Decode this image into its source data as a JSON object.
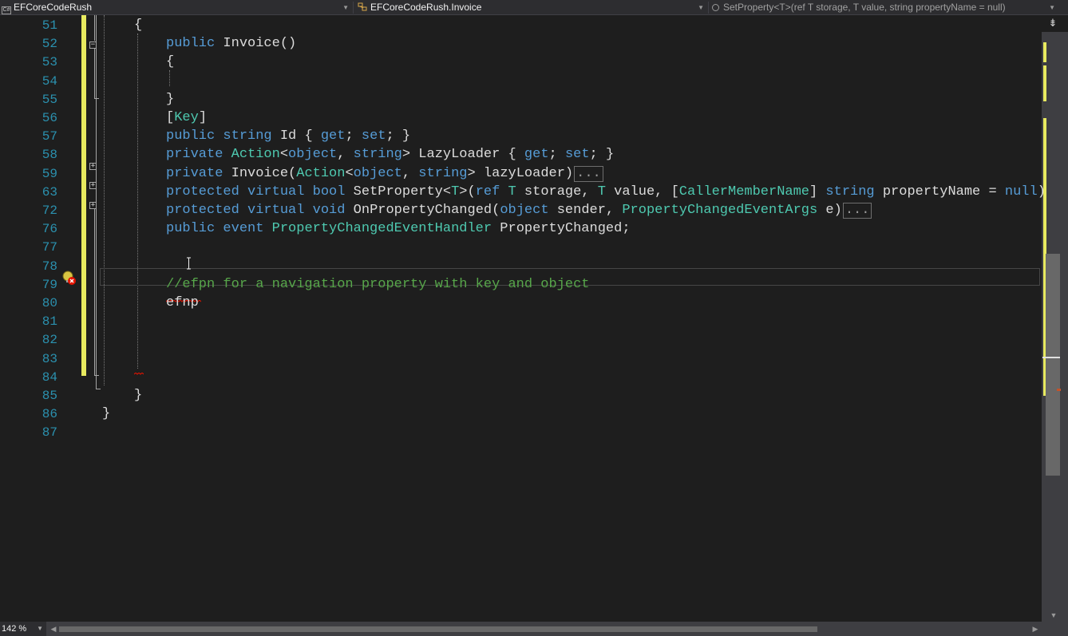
{
  "nav_bar": {
    "project": "EFCoreCodeRush",
    "class": "EFCoreCodeRush.Invoice",
    "member": "SetProperty<T>(ref T storage, T value, string propertyName = null)"
  },
  "icons": {
    "project": "csharp-project-icon",
    "class": "class-icon",
    "member": "method-icon",
    "split": "split-window-icon",
    "lightbulb": "lightbulb-error-icon"
  },
  "colors": {
    "keyword": "#569cd6",
    "type": "#4ec9b0",
    "comment": "#57a64a",
    "line_number": "#2b91af",
    "change_bar": "#e8ea5f"
  },
  "editor": {
    "line_numbers": [
      "51",
      "52",
      "53",
      "54",
      "55",
      "56",
      "57",
      "58",
      "59",
      "63",
      "72",
      "76",
      "77",
      "78",
      "79",
      "80",
      "81",
      "82",
      "83",
      "84",
      "85",
      "86",
      "87"
    ],
    "code_lines": [
      {
        "tokens": [
          {
            "t": "{",
            "c": "pl"
          }
        ]
      },
      {
        "tokens": [
          {
            "t": "public",
            "c": "kw"
          },
          {
            "t": " Invoice()",
            "c": "pl"
          }
        ]
      },
      {
        "tokens": [
          {
            "t": "{",
            "c": "pl"
          }
        ]
      },
      {
        "tokens": []
      },
      {
        "tokens": [
          {
            "t": "}",
            "c": "pl"
          }
        ]
      },
      {
        "tokens": [
          {
            "t": "[",
            "c": "pl"
          },
          {
            "t": "Key",
            "c": "ty"
          },
          {
            "t": "]",
            "c": "pl"
          }
        ]
      },
      {
        "tokens": [
          {
            "t": "public",
            "c": "kw"
          },
          {
            "t": " ",
            "c": "pl"
          },
          {
            "t": "string",
            "c": "kw"
          },
          {
            "t": " Id { ",
            "c": "pl"
          },
          {
            "t": "get",
            "c": "kw"
          },
          {
            "t": "; ",
            "c": "pl"
          },
          {
            "t": "set",
            "c": "kw"
          },
          {
            "t": "; }",
            "c": "pl"
          }
        ]
      },
      {
        "tokens": [
          {
            "t": "private",
            "c": "kw"
          },
          {
            "t": " ",
            "c": "pl"
          },
          {
            "t": "Action",
            "c": "ty"
          },
          {
            "t": "<",
            "c": "pl"
          },
          {
            "t": "object",
            "c": "kw"
          },
          {
            "t": ", ",
            "c": "pl"
          },
          {
            "t": "string",
            "c": "kw"
          },
          {
            "t": "> LazyLoader { ",
            "c": "pl"
          },
          {
            "t": "get",
            "c": "kw"
          },
          {
            "t": "; ",
            "c": "pl"
          },
          {
            "t": "set",
            "c": "kw"
          },
          {
            "t": "; }",
            "c": "pl"
          }
        ]
      },
      {
        "tokens": [
          {
            "t": "private",
            "c": "kw"
          },
          {
            "t": " Invoice(",
            "c": "pl"
          },
          {
            "t": "Action",
            "c": "ty"
          },
          {
            "t": "<",
            "c": "pl"
          },
          {
            "t": "object",
            "c": "kw"
          },
          {
            "t": ", ",
            "c": "pl"
          },
          {
            "t": "string",
            "c": "kw"
          },
          {
            "t": "> lazyLoader)",
            "c": "pl"
          }
        ],
        "collapsed": "..."
      },
      {
        "tokens": [
          {
            "t": "protected",
            "c": "kw"
          },
          {
            "t": " ",
            "c": "pl"
          },
          {
            "t": "virtual",
            "c": "kw"
          },
          {
            "t": " ",
            "c": "pl"
          },
          {
            "t": "bool",
            "c": "kw"
          },
          {
            "t": " SetProperty<",
            "c": "pl"
          },
          {
            "t": "T",
            "c": "ty"
          },
          {
            "t": ">(",
            "c": "pl"
          },
          {
            "t": "ref",
            "c": "kw"
          },
          {
            "t": " ",
            "c": "pl"
          },
          {
            "t": "T",
            "c": "ty"
          },
          {
            "t": " storage, ",
            "c": "pl"
          },
          {
            "t": "T",
            "c": "ty"
          },
          {
            "t": " value, [",
            "c": "pl"
          },
          {
            "t": "CallerMemberName",
            "c": "ty"
          },
          {
            "t": "] ",
            "c": "pl"
          },
          {
            "t": "string",
            "c": "kw"
          },
          {
            "t": " propertyName = ",
            "c": "pl"
          },
          {
            "t": "null",
            "c": "kw"
          },
          {
            "t": ")",
            "c": "pl"
          }
        ]
      },
      {
        "tokens": [
          {
            "t": "protected",
            "c": "kw"
          },
          {
            "t": " ",
            "c": "pl"
          },
          {
            "t": "virtual",
            "c": "kw"
          },
          {
            "t": " ",
            "c": "pl"
          },
          {
            "t": "void",
            "c": "kw"
          },
          {
            "t": " OnPropertyChanged(",
            "c": "pl"
          },
          {
            "t": "object",
            "c": "kw"
          },
          {
            "t": " sender, ",
            "c": "pl"
          },
          {
            "t": "PropertyChangedEventArgs",
            "c": "ty"
          },
          {
            "t": " e)",
            "c": "pl"
          }
        ],
        "collapsed": "..."
      },
      {
        "tokens": [
          {
            "t": "public",
            "c": "kw"
          },
          {
            "t": " ",
            "c": "pl"
          },
          {
            "t": "event",
            "c": "kw"
          },
          {
            "t": " ",
            "c": "pl"
          },
          {
            "t": "PropertyChangedEventHandler",
            "c": "ty"
          },
          {
            "t": " PropertyChanged;",
            "c": "pl"
          }
        ]
      },
      {
        "tokens": []
      },
      {
        "tokens": []
      },
      {
        "tokens": [
          {
            "t": "//efpn for a navigation property with key and object",
            "c": "cm"
          }
        ]
      },
      {
        "tokens": [
          {
            "t": "efnp",
            "c": "pl"
          }
        ]
      },
      {
        "tokens": []
      },
      {
        "tokens": []
      },
      {
        "tokens": []
      },
      {
        "tokens": []
      },
      {
        "tokens": [
          {
            "t": "}",
            "c": "pl"
          }
        ]
      },
      {
        "tokens": [
          {
            "t": "}",
            "c": "pl"
          }
        ]
      },
      {
        "tokens": []
      }
    ]
  },
  "zoom_level": "142 %"
}
